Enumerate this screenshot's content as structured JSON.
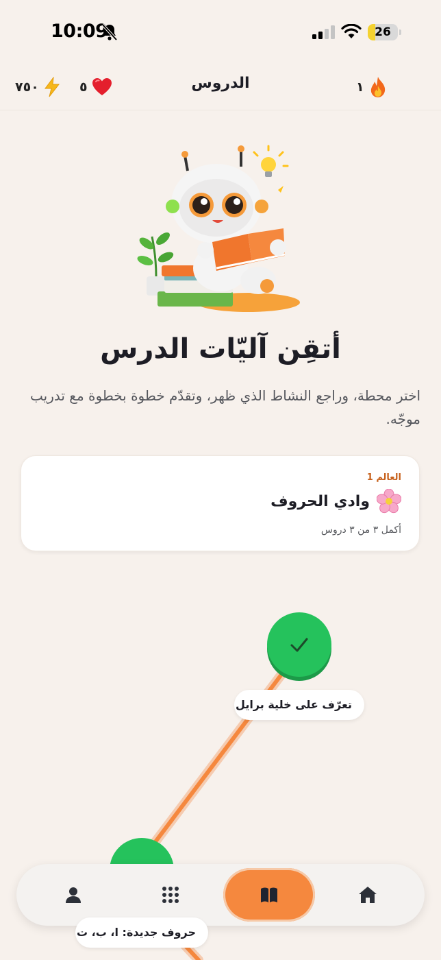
{
  "status_bar": {
    "time": "10:09",
    "battery_level": "26",
    "battery_fraction": 0.26,
    "icons": [
      "bell-off-icon",
      "cellular-signal-icon",
      "wifi-icon",
      "battery-icon"
    ]
  },
  "header": {
    "title": "الدروس",
    "energy": "٧٥٠",
    "hearts": "٥",
    "streak": "١",
    "icons": [
      "bolt-icon",
      "heart-icon",
      "fire-icon"
    ]
  },
  "hero": {
    "title": "أتقِن آليّات الدرس",
    "subtitle": "اختر محطة، وراجع النشاط الذي ظهر، وتقدّم خطوة بخطوة مع تدريب موجّه."
  },
  "world_card": {
    "kicker": "العالم 1",
    "name": "وادي الحروف",
    "progress": "أكمل ٣ من ٣ دروس",
    "icon": "blossom-icon"
  },
  "path": {
    "nodes": [
      {
        "label": "تعرّف على خلية برايل",
        "status": "completed"
      },
      {
        "label": "حروف جديدة: ا، ب، ت",
        "status": "completed"
      }
    ]
  },
  "bottom_nav": {
    "items": [
      {
        "icon": "person-icon",
        "active": false
      },
      {
        "icon": "grid-icon",
        "active": false
      },
      {
        "icon": "book-icon",
        "active": true
      },
      {
        "icon": "home-icon",
        "active": false
      }
    ]
  },
  "colors": {
    "background": "#f7f1ec",
    "accent": "#f5883e",
    "success": "#25c25c",
    "kicker": "#c7611c"
  }
}
